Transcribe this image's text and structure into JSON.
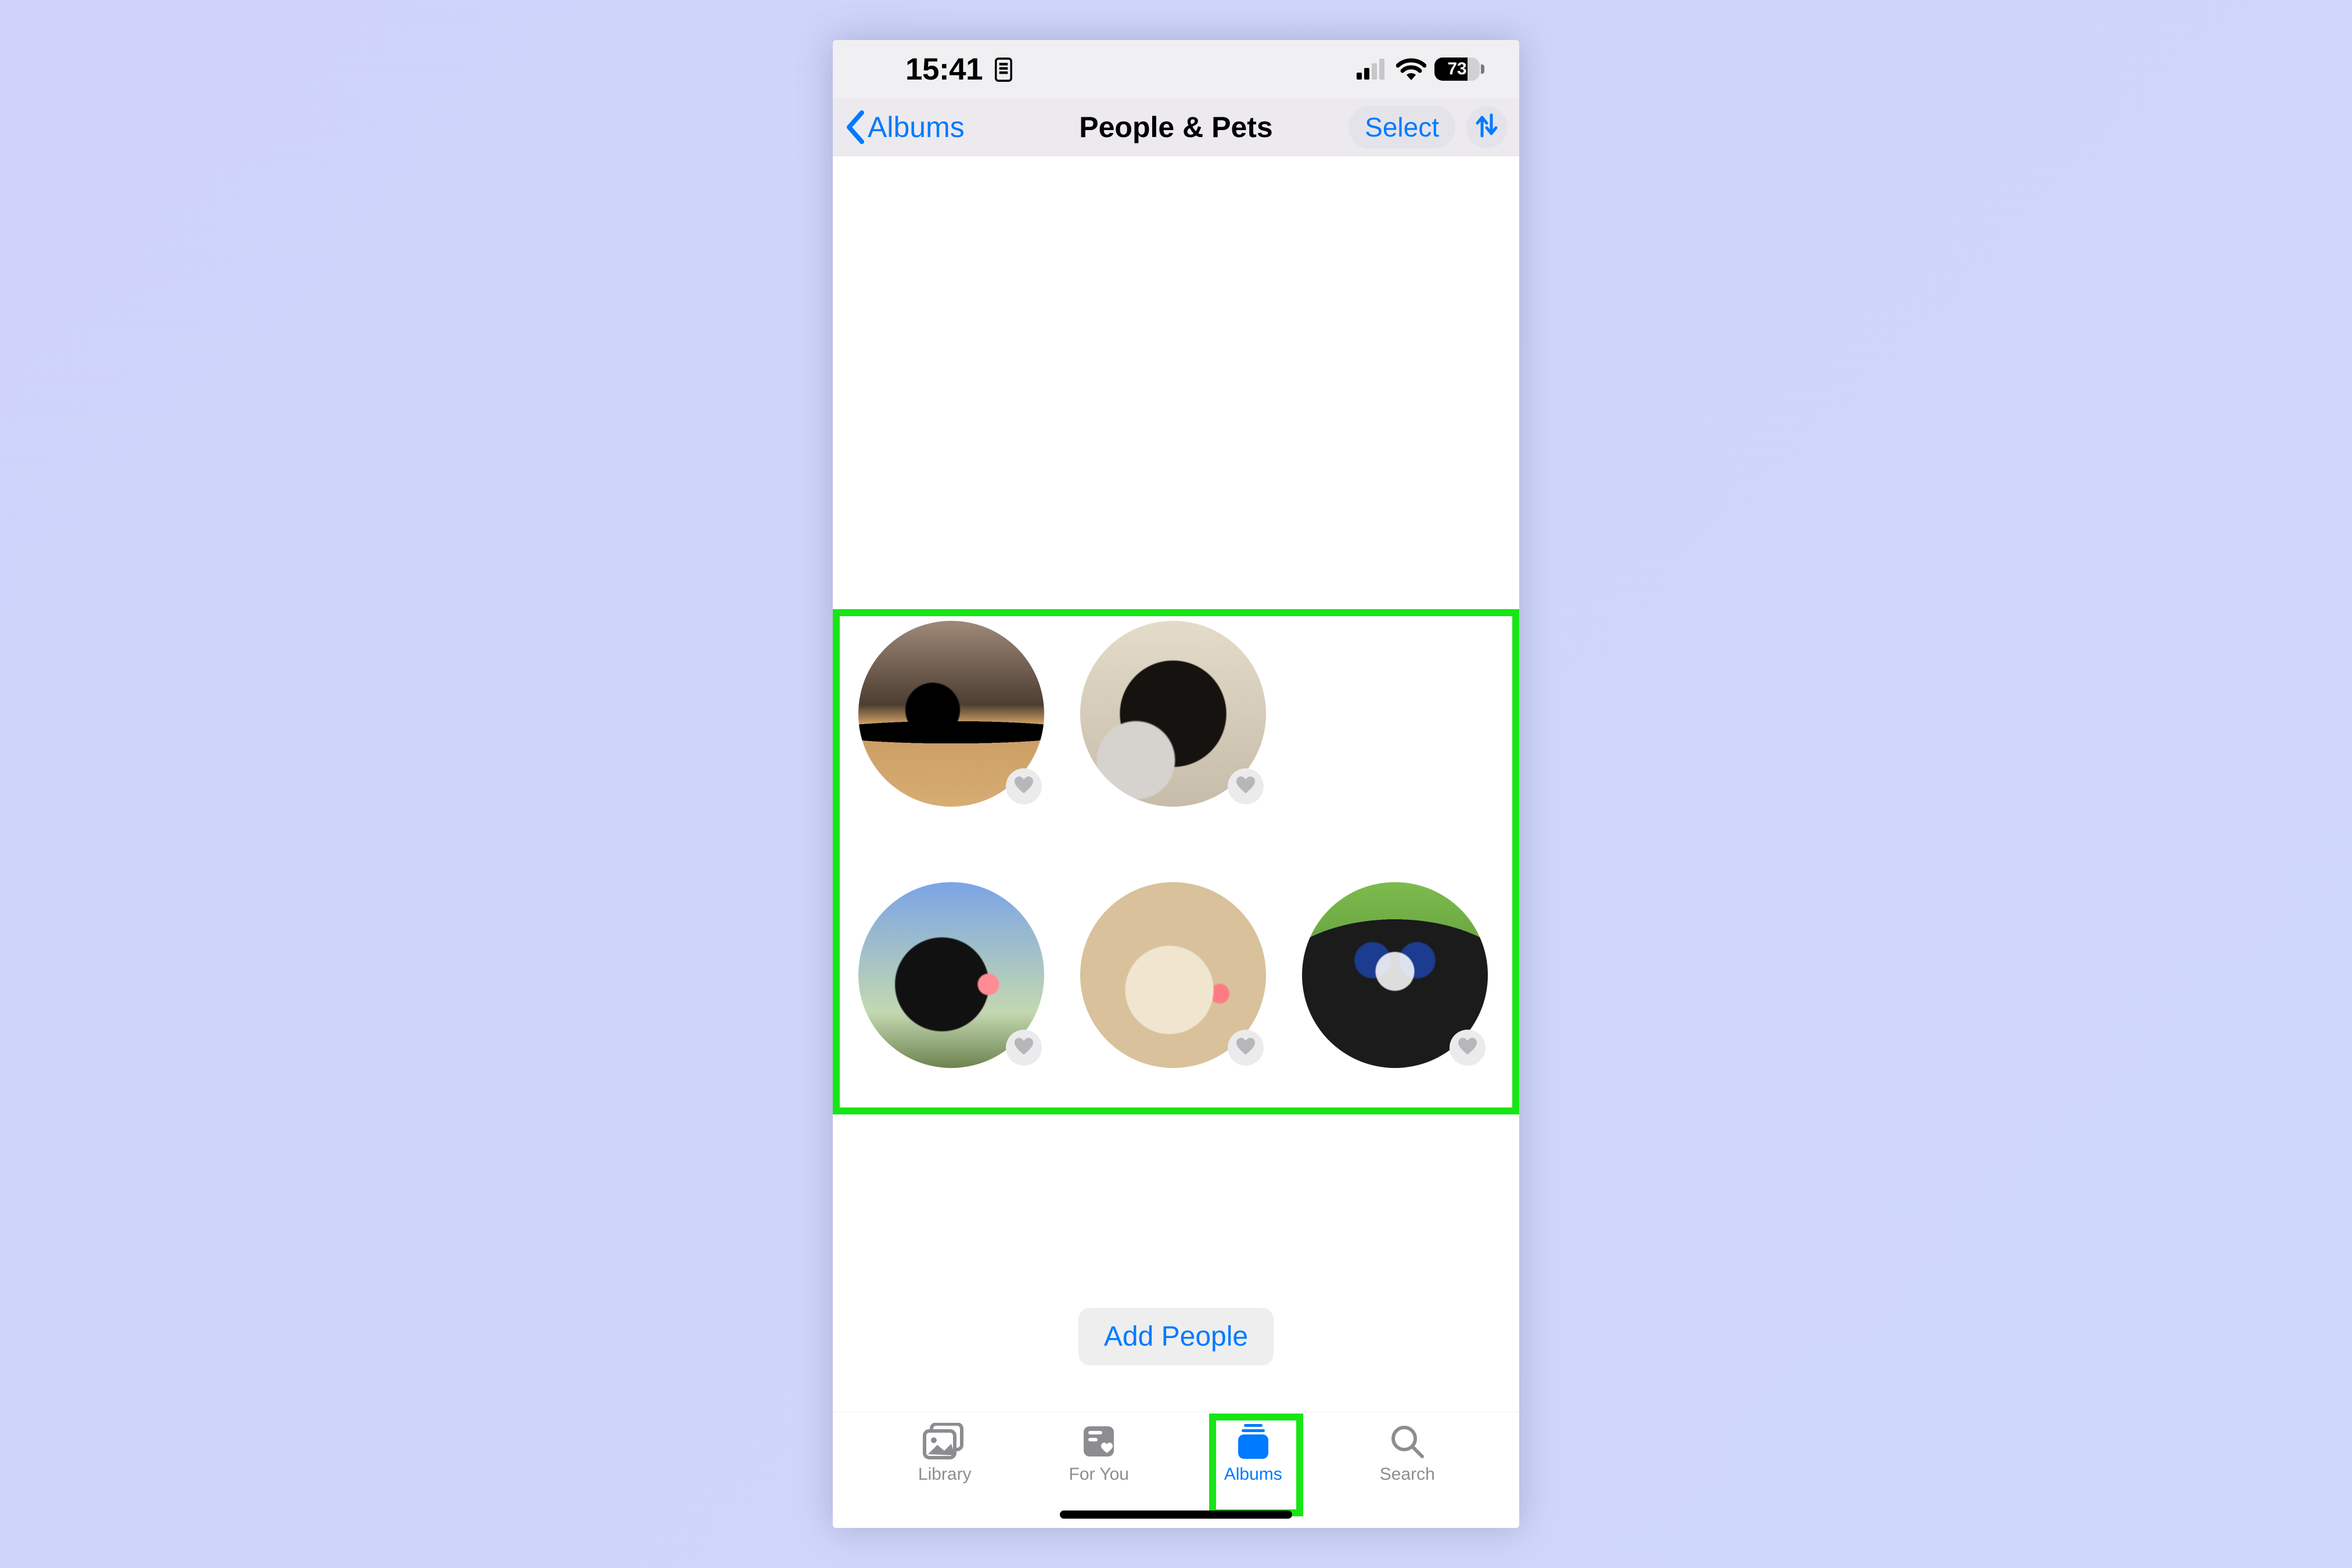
{
  "status": {
    "time": "15:41",
    "battery_percent": "73"
  },
  "nav": {
    "back_label": "Albums",
    "title": "People & Pets",
    "select_label": "Select"
  },
  "buttons": {
    "add_people": "Add People"
  },
  "tabs": {
    "library": "Library",
    "for_you": "For You",
    "albums": "Albums",
    "search": "Search"
  },
  "colors": {
    "accent": "#007aff",
    "highlight": "#18e516"
  }
}
